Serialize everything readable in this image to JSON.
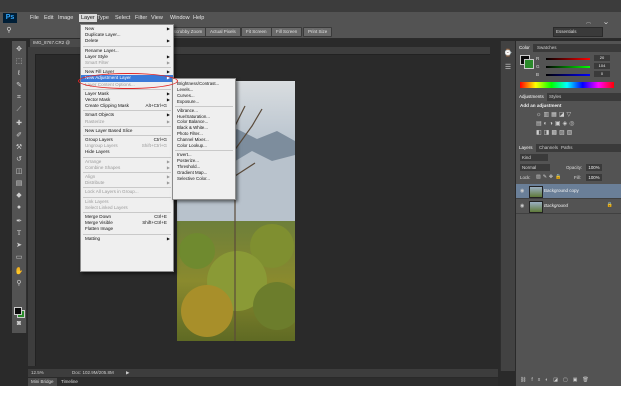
{
  "app": {
    "logo": "Ps"
  },
  "menubar": {
    "items": [
      "File",
      "Edit",
      "Image",
      "Layer",
      "Type",
      "Select",
      "Filter",
      "View",
      "Window",
      "Help"
    ],
    "active": "Layer",
    "window_controls": [
      "–",
      "□",
      "✕"
    ]
  },
  "options_bar": {
    "buttons": [
      "Scrubby Zoom",
      "Actual Pixels",
      "Fit Screen",
      "Fill Screen",
      "Print Size"
    ],
    "workspace": "Essentials"
  },
  "document": {
    "tab": "IMG_8767.CR2 @ 12.5..."
  },
  "status": {
    "zoom": "12.5%",
    "doc": "Doc: 102.9M/205.8M"
  },
  "bottom_tabs": [
    "Mini Bridge",
    "Timeline"
  ],
  "layer_menu": [
    {
      "label": "New",
      "arrow": true
    },
    {
      "label": "Duplicate Layer..."
    },
    {
      "label": "Delete",
      "arrow": true
    },
    {
      "sep": true
    },
    {
      "label": "Rename Layer..."
    },
    {
      "label": "Layer Style",
      "arrow": true
    },
    {
      "label": "Smart Filter",
      "disabled": true,
      "arrow": true
    },
    {
      "sep": true
    },
    {
      "label": "New Fill Layer",
      "arrow": true
    },
    {
      "label": "New Adjustment Layer",
      "arrow": true,
      "highlight": true
    },
    {
      "label": "Layer Content Options...",
      "disabled": true
    },
    {
      "sep": true
    },
    {
      "label": "Layer Mask",
      "arrow": true
    },
    {
      "label": "Vector Mask",
      "arrow": true
    },
    {
      "label": "Create Clipping Mask",
      "shortcut": "Alt+Ctrl+G"
    },
    {
      "sep": true
    },
    {
      "label": "Smart Objects",
      "arrow": true
    },
    {
      "label": "Rasterize",
      "disabled": true,
      "arrow": true
    },
    {
      "sep": true
    },
    {
      "label": "New Layer Based Slice"
    },
    {
      "sep": true
    },
    {
      "label": "Group Layers",
      "shortcut": "Ctrl+G"
    },
    {
      "label": "Ungroup Layers",
      "shortcut": "Shift+Ctrl+G",
      "disabled": true
    },
    {
      "label": "Hide Layers"
    },
    {
      "sep": true
    },
    {
      "label": "Arrange",
      "arrow": true,
      "disabled": true
    },
    {
      "label": "Combine Shapes",
      "arrow": true,
      "disabled": true
    },
    {
      "sep": true
    },
    {
      "label": "Align",
      "arrow": true,
      "disabled": true
    },
    {
      "label": "Distribute",
      "arrow": true,
      "disabled": true
    },
    {
      "sep": true
    },
    {
      "label": "Lock All Layers in Group...",
      "disabled": true
    },
    {
      "sep": true
    },
    {
      "label": "Link Layers",
      "disabled": true
    },
    {
      "label": "Select Linked Layers",
      "disabled": true
    },
    {
      "sep": true
    },
    {
      "label": "Merge Down",
      "shortcut": "Ctrl+E"
    },
    {
      "label": "Merge Visible",
      "shortcut": "Shift+Ctrl+E"
    },
    {
      "label": "Flatten Image"
    },
    {
      "sep": true
    },
    {
      "label": "Matting",
      "arrow": true
    }
  ],
  "adjustment_submenu": [
    "Brightness/Contrast...",
    "Levels...",
    "Curves...",
    "Exposure...",
    "",
    "Vibrance...",
    "Hue/Saturation...",
    "Color Balance...",
    "Black & White...",
    "Photo Filter...",
    "Channel Mixer...",
    "Color Lookup...",
    "",
    "Invert...",
    "Posterize...",
    "Threshold...",
    "Gradient Map...",
    "Selective Color..."
  ],
  "color_panel": {
    "tabs": [
      "Color",
      "Swatches"
    ],
    "rows": [
      {
        "label": "R",
        "value": "20"
      },
      {
        "label": "G",
        "value": "104"
      },
      {
        "label": "B",
        "value": "0"
      }
    ]
  },
  "adjustments_panel": {
    "tabs": [
      "Adjustments",
      "Styles"
    ],
    "heading": "Add an adjustment"
  },
  "layers_panel": {
    "tabs": [
      "Layers",
      "Channels",
      "Paths"
    ],
    "kind": "Kind",
    "blend": "Normal",
    "opacity_label": "Opacity:",
    "opacity": "100%",
    "lock_label": "Lock:",
    "fill_label": "Fill:",
    "fill": "100%",
    "layers": [
      {
        "name": "Background copy",
        "selected": true
      },
      {
        "name": "Background",
        "selected": false
      }
    ]
  },
  "colors": {
    "menu_highlight": "#3a7ad9",
    "annotation": "#e02525",
    "fg": "#0a0a0a",
    "bg": "#2a8a2a"
  }
}
